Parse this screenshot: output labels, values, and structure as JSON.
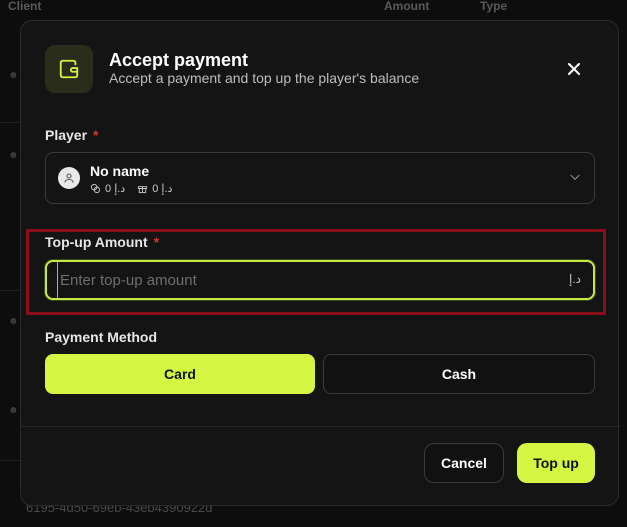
{
  "background": {
    "columns": [
      "Client",
      "Amount",
      "Type"
    ],
    "bottom_text": "6195-4d50-69eb-43eb4390922d"
  },
  "modal": {
    "title": "Accept payment",
    "subtitle": "Accept a payment and top up the player's balance",
    "icon": "wallet-icon",
    "player": {
      "label": "Player",
      "required_mark": "*",
      "name": "No name",
      "balance_1": "0 د.إ",
      "balance_2": "0 د.إ"
    },
    "amount": {
      "label": "Top-up Amount",
      "required_mark": "*",
      "placeholder": "Enter top-up amount",
      "value": "",
      "currency": "د.إ"
    },
    "payment_method": {
      "label": "Payment Method",
      "options": [
        "Card",
        "Cash"
      ],
      "selected": "Card"
    },
    "buttons": {
      "cancel": "Cancel",
      "submit": "Top up"
    }
  },
  "colors": {
    "accent": "#d4f542",
    "required": "#e0303a",
    "highlight_border": "#8a0f1a",
    "modal_bg": "#141414"
  }
}
